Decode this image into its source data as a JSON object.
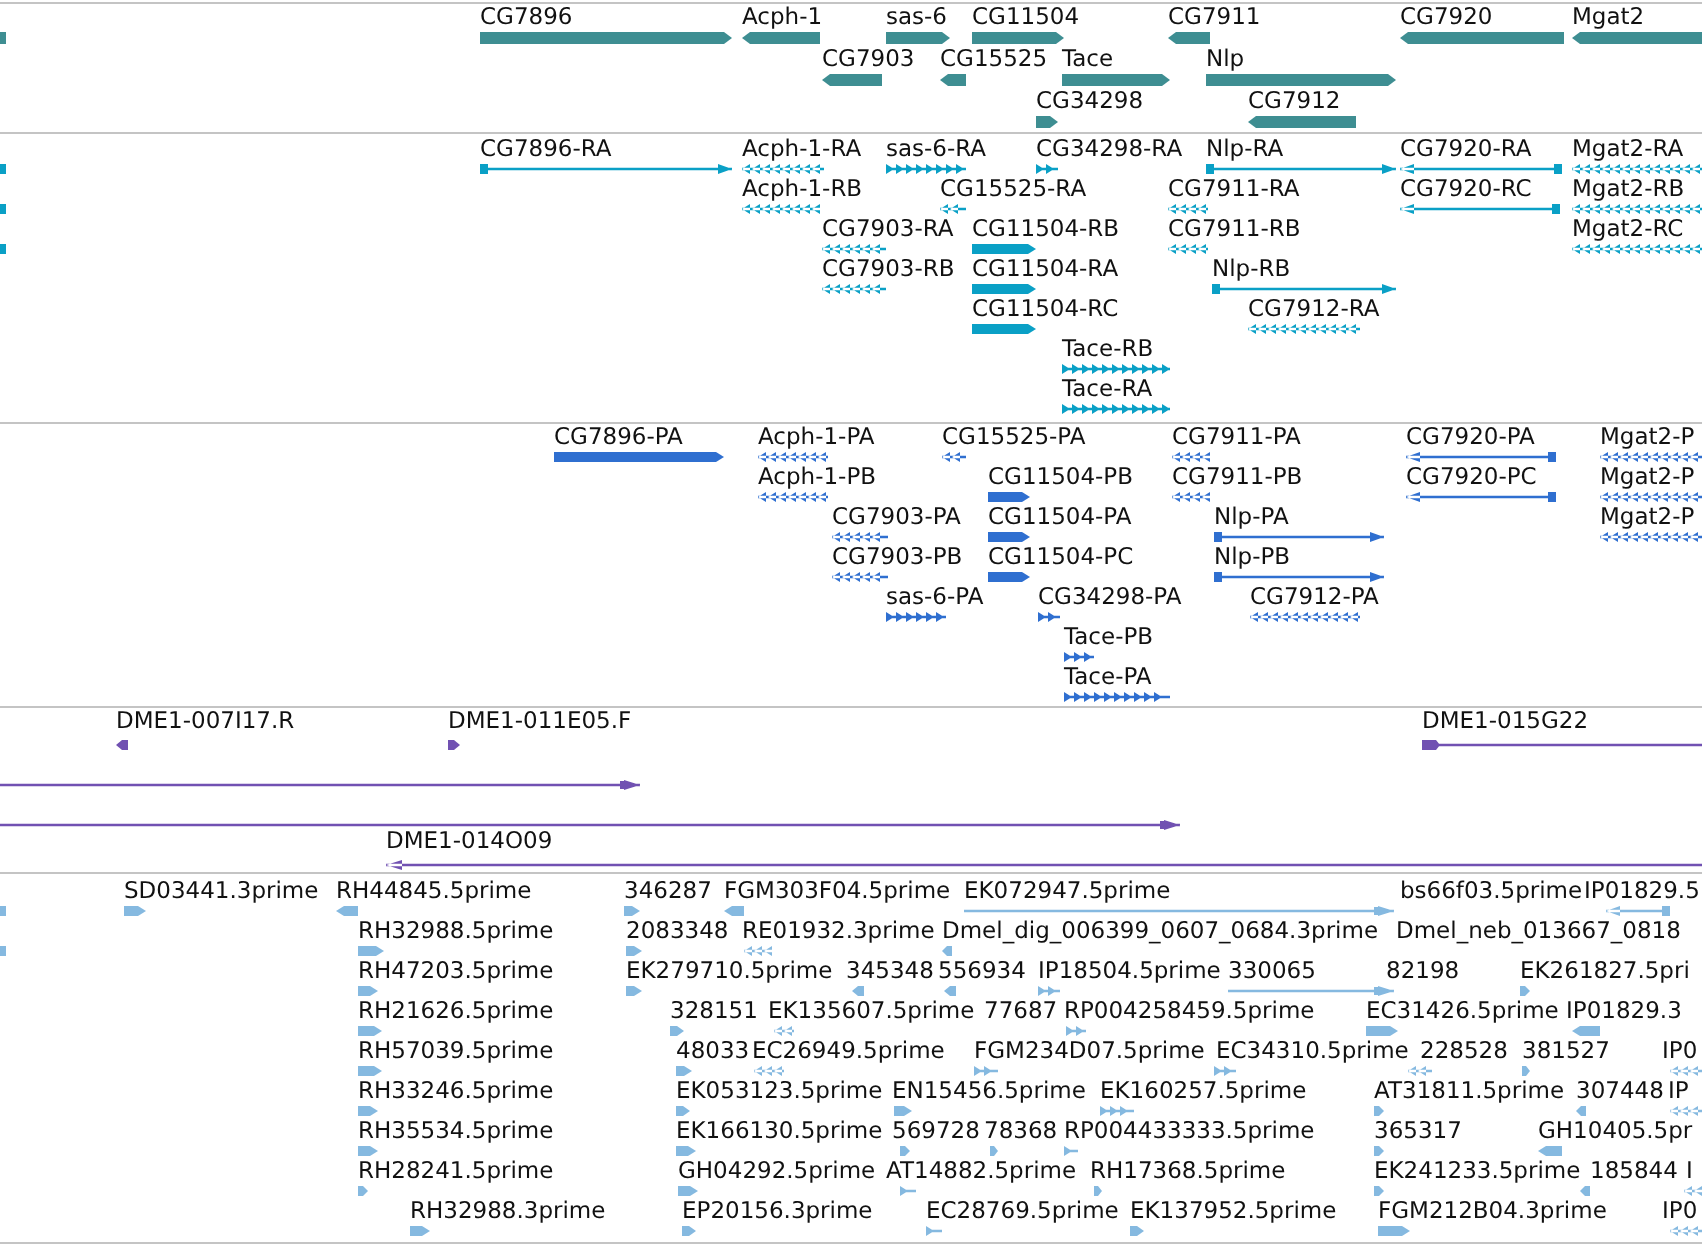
{
  "tracks": [
    {
      "kind": "gene",
      "features": [
        {
          "label": "CG7896",
          "reverse": false
        },
        {
          "label": "Acph-1",
          "reverse": true
        },
        {
          "label": "sas-6",
          "reverse": false
        },
        {
          "label": "CG11504",
          "reverse": false
        },
        {
          "label": "CG7911",
          "reverse": true
        },
        {
          "label": "CG7920",
          "reverse": true
        },
        {
          "label": "Mgat2",
          "reverse": true
        },
        {
          "label": "CG7903",
          "reverse": true
        },
        {
          "label": "CG15525",
          "reverse": true
        },
        {
          "label": "Tace",
          "reverse": false
        },
        {
          "label": "Nlp",
          "reverse": false
        },
        {
          "label": "CG34298",
          "reverse": false
        },
        {
          "label": "CG7912",
          "reverse": true
        }
      ]
    },
    {
      "kind": "transcript",
      "features": [
        {
          "label": "CG7896-RA",
          "reverse": false
        },
        {
          "label": "Acph-1-RA",
          "reverse": true
        },
        {
          "label": "sas-6-RA",
          "reverse": false
        },
        {
          "label": "CG34298-RA",
          "reverse": false
        },
        {
          "label": "Nlp-RA",
          "reverse": false
        },
        {
          "label": "CG7920-RA",
          "reverse": true
        },
        {
          "label": "Mgat2-RA",
          "reverse": true
        },
        {
          "label": "Acph-1-RB",
          "reverse": true
        },
        {
          "label": "CG15525-RA",
          "reverse": true
        },
        {
          "label": "CG7911-RA",
          "reverse": true
        },
        {
          "label": "CG7920-RC",
          "reverse": true
        },
        {
          "label": "Mgat2-RB",
          "reverse": true
        },
        {
          "label": "CG7903-RA",
          "reverse": true
        },
        {
          "label": "CG11504-RB",
          "reverse": false
        },
        {
          "label": "CG7911-RB",
          "reverse": true
        },
        {
          "label": "Mgat2-RC",
          "reverse": true
        },
        {
          "label": "CG7903-RB",
          "reverse": true
        },
        {
          "label": "CG11504-RA",
          "reverse": false
        },
        {
          "label": "Nlp-RB",
          "reverse": false
        },
        {
          "label": "CG11504-RC",
          "reverse": false
        },
        {
          "label": "CG7912-RA",
          "reverse": true
        },
        {
          "label": "Tace-RB",
          "reverse": false
        },
        {
          "label": "Tace-RA",
          "reverse": false
        }
      ]
    },
    {
      "kind": "protein",
      "features": [
        {
          "label": "CG7896-PA",
          "reverse": false
        },
        {
          "label": "Acph-1-PA",
          "reverse": true
        },
        {
          "label": "CG15525-PA",
          "reverse": true
        },
        {
          "label": "CG7911-PA",
          "reverse": true
        },
        {
          "label": "CG7920-PA",
          "reverse": true
        },
        {
          "label": "Mgat2-P",
          "reverse": true
        },
        {
          "label": "Acph-1-PB",
          "reverse": true
        },
        {
          "label": "CG11504-PB",
          "reverse": false
        },
        {
          "label": "CG7911-PB",
          "reverse": true
        },
        {
          "label": "CG7920-PC",
          "reverse": true
        },
        {
          "label": "Mgat2-P",
          "reverse": true
        },
        {
          "label": "CG7903-PA",
          "reverse": true
        },
        {
          "label": "CG11504-PA",
          "reverse": false
        },
        {
          "label": "Nlp-PA",
          "reverse": false
        },
        {
          "label": "Mgat2-P",
          "reverse": true
        },
        {
          "label": "CG7903-PB",
          "reverse": true
        },
        {
          "label": "CG11504-PC",
          "reverse": false
        },
        {
          "label": "Nlp-PB",
          "reverse": false
        },
        {
          "label": "sas-6-PA",
          "reverse": false
        },
        {
          "label": "CG34298-PA",
          "reverse": false
        },
        {
          "label": "CG7912-PA",
          "reverse": true
        },
        {
          "label": "Tace-PB",
          "reverse": false
        },
        {
          "label": "Tace-PA",
          "reverse": false
        }
      ]
    },
    {
      "kind": "clone",
      "features": [
        {
          "label": "DME1-007I17.R",
          "reverse": true
        },
        {
          "label": "DME1-011E05.F",
          "reverse": false
        },
        {
          "label": "DME1-015G22",
          "reverse": false
        },
        {
          "label": "DME1-014O09",
          "reverse": true
        }
      ]
    },
    {
      "kind": "est",
      "features": [
        {
          "label": "SD03441.3prime",
          "reverse": false
        },
        {
          "label": "RH44845.5prime",
          "reverse": true
        },
        {
          "label": "346287",
          "reverse": false
        },
        {
          "label": "FGM303F04.5prime",
          "reverse": true
        },
        {
          "label": "EK072947.5prime",
          "reverse": false
        },
        {
          "label": "bs66f03.5prime"
        },
        {
          "label": "IP01829.5",
          "reverse": true
        },
        {
          "label": "RH32988.5prime",
          "reverse": false
        },
        {
          "label": "2083348",
          "reverse": false
        },
        {
          "label": "RE01932.3prime",
          "reverse": true
        },
        {
          "label": "Dmel_dig_006399_0607_0684.3prime",
          "reverse": true
        },
        {
          "label": "Dmel_neb_013667_0818"
        },
        {
          "label": "RH47203.5prime",
          "reverse": false
        },
        {
          "label": "EK279710.5prime",
          "reverse": false
        },
        {
          "label": "345348",
          "reverse": true
        },
        {
          "label": "556934",
          "reverse": true
        },
        {
          "label": "IP18504.5prime",
          "reverse": false
        },
        {
          "label": "330065",
          "reverse": false
        },
        {
          "label": "82198"
        },
        {
          "label": "EK261827.5pri",
          "reverse": false
        },
        {
          "label": "RH21626.5prime",
          "reverse": false
        },
        {
          "label": "328151",
          "reverse": false
        },
        {
          "label": "EK135607.5prime",
          "reverse": true
        },
        {
          "label": "77687"
        },
        {
          "label": "RP004258459.5prime",
          "reverse": false
        },
        {
          "label": "EC31426.5prime",
          "reverse": false
        },
        {
          "label": "IP01829.3",
          "reverse": true
        },
        {
          "label": "RH57039.5prime",
          "reverse": false
        },
        {
          "label": "48033",
          "reverse": false
        },
        {
          "label": "EC26949.5prime",
          "reverse": true
        },
        {
          "label": "FGM234D07.5prime",
          "reverse": false
        },
        {
          "label": "EC34310.5prime",
          "reverse": false
        },
        {
          "label": "228528",
          "reverse": true
        },
        {
          "label": "381527",
          "reverse": false
        },
        {
          "label": "IP0",
          "reverse": true
        },
        {
          "label": "RH33246.5prime",
          "reverse": false
        },
        {
          "label": "EK053123.5prime",
          "reverse": false
        },
        {
          "label": "EN15456.5prime",
          "reverse": false
        },
        {
          "label": "EK160257.5prime",
          "reverse": false
        },
        {
          "label": "AT31811.5prime",
          "reverse": false
        },
        {
          "label": "307448",
          "reverse": true
        },
        {
          "label": "IP",
          "reverse": true
        },
        {
          "label": "RH35534.5prime",
          "reverse": false
        },
        {
          "label": "EK166130.5prime",
          "reverse": false
        },
        {
          "label": "569728",
          "reverse": false
        },
        {
          "label": "78368",
          "reverse": false
        },
        {
          "label": "RP004433333.5prime",
          "reverse": false
        },
        {
          "label": "365317",
          "reverse": false
        },
        {
          "label": "GH10405.5pr",
          "reverse": true
        },
        {
          "label": "RH28241.5prime",
          "reverse": false
        },
        {
          "label": "GH04292.5prime",
          "reverse": false
        },
        {
          "label": "AT14882.5prime",
          "reverse": false
        },
        {
          "label": "RH17368.5prime",
          "reverse": false
        },
        {
          "label": "EK241233.5prime",
          "reverse": false
        },
        {
          "label": "185844",
          "reverse": true
        },
        {
          "label": "I",
          "reverse": true
        },
        {
          "label": "RH32988.3prime",
          "reverse": false
        },
        {
          "label": "EP20156.3prime",
          "reverse": false
        },
        {
          "label": "EC28769.5prime",
          "reverse": false
        },
        {
          "label": "EK137952.5prime",
          "reverse": false
        },
        {
          "label": "FGM212B04.3prime",
          "reverse": false
        },
        {
          "label": "IP0",
          "reverse": true
        }
      ]
    }
  ]
}
